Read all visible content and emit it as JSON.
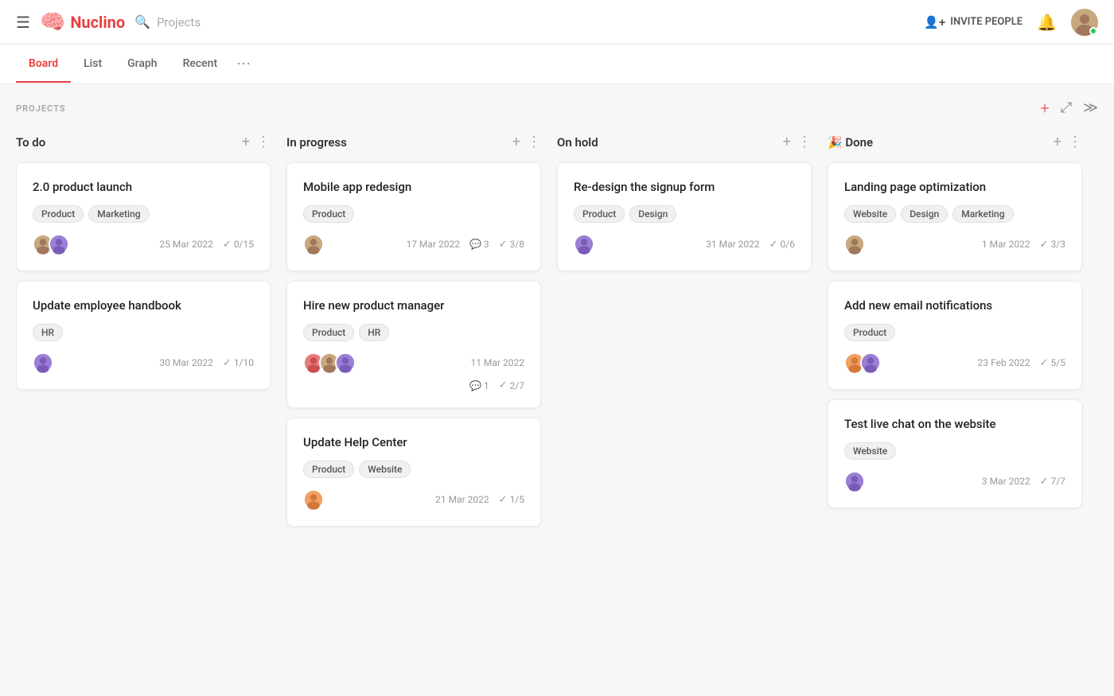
{
  "app": {
    "logo_text": "Nuclino",
    "search_placeholder": "Projects"
  },
  "topbar": {
    "invite_label": "INVITE PEOPLE",
    "notifications_icon": "🔔"
  },
  "tabs": [
    {
      "id": "board",
      "label": "Board",
      "active": true
    },
    {
      "id": "list",
      "label": "List",
      "active": false
    },
    {
      "id": "graph",
      "label": "Graph",
      "active": false
    },
    {
      "id": "recent",
      "label": "Recent",
      "active": false
    }
  ],
  "projects_label": "PROJECTS",
  "columns": [
    {
      "id": "todo",
      "title": "To do",
      "emoji": "",
      "cards": [
        {
          "id": "card-1",
          "title": "2.0 product launch",
          "tags": [
            "Product",
            "Marketing"
          ],
          "avatars": [
            "av-brown",
            "av-purple"
          ],
          "date": "25 Mar 2022",
          "checks": "0/15",
          "comments": null
        },
        {
          "id": "card-2",
          "title": "Update employee handbook",
          "tags": [
            "HR"
          ],
          "avatars": [
            "av-purple"
          ],
          "date": "30 Mar 2022",
          "checks": "1/10",
          "comments": null
        }
      ]
    },
    {
      "id": "inprogress",
      "title": "In progress",
      "emoji": "",
      "cards": [
        {
          "id": "card-3",
          "title": "Mobile app redesign",
          "tags": [
            "Product"
          ],
          "avatars": [
            "av-brown"
          ],
          "date": "17 Mar 2022",
          "checks": "3/8",
          "comments": "3"
        },
        {
          "id": "card-4",
          "title": "Hire new product manager",
          "tags": [
            "Product",
            "HR"
          ],
          "avatars": [
            "av-red",
            "av-brown",
            "av-purple"
          ],
          "date": "11 Mar 2022",
          "checks": "2/7",
          "comments": "1"
        },
        {
          "id": "card-5",
          "title": "Update Help Center",
          "tags": [
            "Product",
            "Website"
          ],
          "avatars": [
            "av-orange"
          ],
          "date": "21 Mar 2022",
          "checks": "1/5",
          "comments": null
        }
      ]
    },
    {
      "id": "onhold",
      "title": "On hold",
      "emoji": "",
      "cards": [
        {
          "id": "card-6",
          "title": "Re-design the signup form",
          "tags": [
            "Product",
            "Design"
          ],
          "avatars": [
            "av-purple"
          ],
          "date": "31 Mar 2022",
          "checks": "0/6",
          "comments": null
        }
      ]
    },
    {
      "id": "done",
      "title": "Done",
      "emoji": "🎉",
      "cards": [
        {
          "id": "card-7",
          "title": "Landing page optimization",
          "tags": [
            "Website",
            "Design",
            "Marketing"
          ],
          "avatars": [
            "av-brown"
          ],
          "date": "1 Mar 2022",
          "checks": "3/3",
          "comments": null
        },
        {
          "id": "card-8",
          "title": "Add new email notifications",
          "tags": [
            "Product"
          ],
          "avatars": [
            "av-orange",
            "av-purple"
          ],
          "date": "23 Feb 2022",
          "checks": "5/5",
          "comments": null
        },
        {
          "id": "card-9",
          "title": "Test live chat on the website",
          "tags": [
            "Website"
          ],
          "avatars": [
            "av-purple"
          ],
          "date": "3 Mar 2022",
          "checks": "7/7",
          "comments": null
        }
      ]
    }
  ]
}
